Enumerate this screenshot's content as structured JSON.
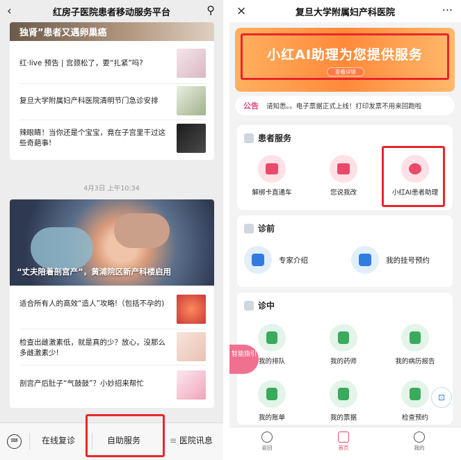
{
  "left": {
    "title": "红房子医院患者移动服务平台",
    "banner_text": "独肾”患者又遇卵巢癌",
    "articles_top": [
      {
        "text": "红·live 预告 | 宫颈松了，要“扎紧”吗?"
      },
      {
        "text": "复旦大学附属妇产科医院清明节门急诊安排"
      },
      {
        "text": "辣眼睛！当你还是个宝宝，竟在子宫里干过这些奇葩事!"
      }
    ],
    "timestamp": "4月3日 上午10:34",
    "hero_title": "“丈夫陪着剖宫产”，黄浦院区新产科楼启用",
    "articles_bottom": [
      {
        "text": "适合所有人的高效“造人”攻略!（包括不孕的)"
      },
      {
        "text": "检查出雌激素低，就是真的少？放心，没那么多雌激素少!"
      },
      {
        "text": "剖宫产后肚子“气鼓鼓”？小妙招来帮忙"
      }
    ],
    "menu": {
      "item1": "在线复诊",
      "item2": "自助服务",
      "item3": "医院讯息"
    }
  },
  "right": {
    "title": "复旦大学附属妇产科医院",
    "more": "···",
    "promo": {
      "title": "小红AI助理为您提供服务",
      "button": "查看详情"
    },
    "notice": {
      "tag": "公告",
      "text": "请知悉。。电子票据正式上线！打印发票不用来回跑啦"
    },
    "patient_services": {
      "title": "患者服务",
      "items": [
        "解绑卡直通车",
        "您说我改",
        "小红AI患者助理"
      ]
    },
    "pre_diagnosis": {
      "title": "诊前",
      "items": [
        "专家介绍",
        "我的挂号预约"
      ]
    },
    "in_diagnosis": {
      "title": "诊中",
      "items": [
        "我的排队",
        "我的药师",
        "我的病历报告",
        "我的账单",
        "我的票据",
        "检查预约"
      ]
    },
    "guide_tab": "智能指引",
    "tabs": [
      "返回",
      "首页",
      "我的"
    ]
  }
}
